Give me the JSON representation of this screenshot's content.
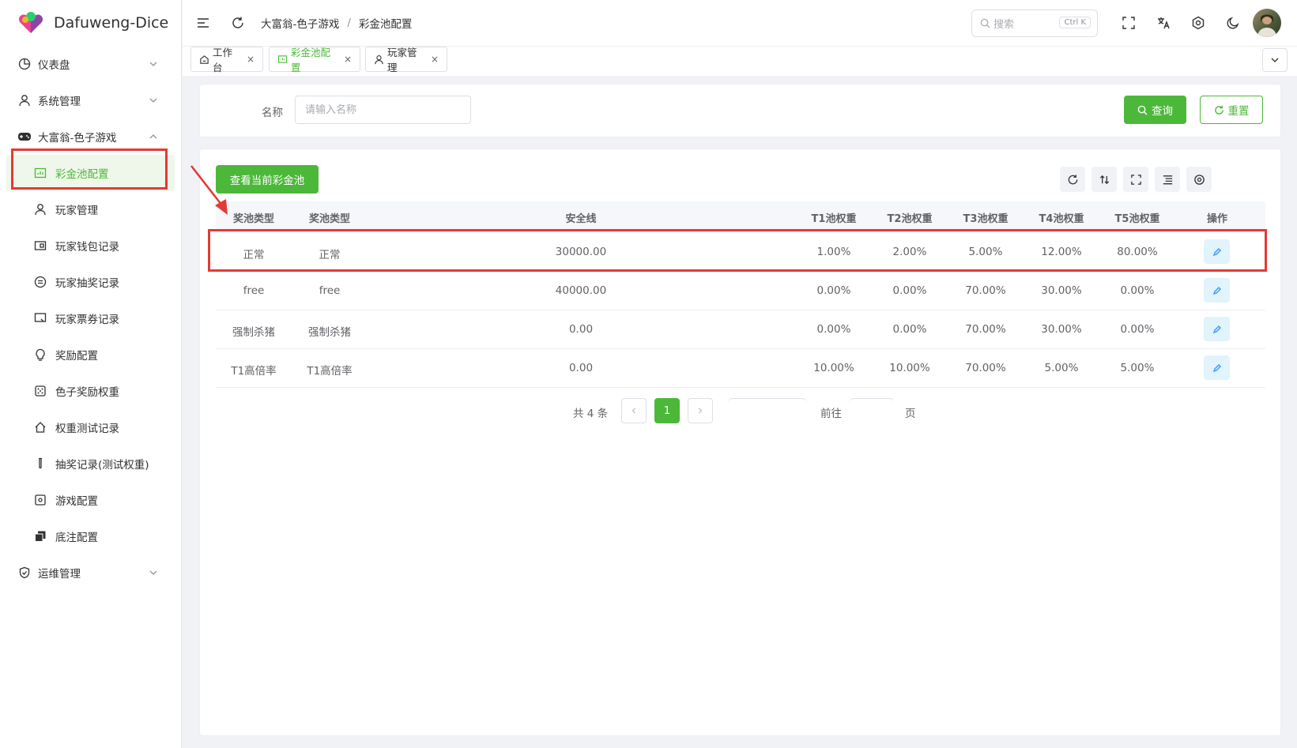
{
  "brand": {
    "name": "Dafuweng-Dice"
  },
  "sidebar": {
    "items": [
      {
        "label": "仪表盘"
      },
      {
        "label": "系统管理"
      },
      {
        "label": "大富翁-色子游戏"
      }
    ],
    "sub_items": [
      {
        "label": "彩金池配置"
      },
      {
        "label": "玩家管理"
      },
      {
        "label": "玩家钱包记录"
      },
      {
        "label": "玩家抽奖记录"
      },
      {
        "label": "玩家票券记录"
      },
      {
        "label": "奖励配置"
      },
      {
        "label": "色子奖励权重"
      },
      {
        "label": "权重测试记录"
      },
      {
        "label": "抽奖记录(测试权重)"
      },
      {
        "label": "游戏配置"
      },
      {
        "label": "底注配置"
      }
    ],
    "ops": {
      "label": "运维管理"
    }
  },
  "header": {
    "breadcrumb": [
      "大富翁-色子游戏",
      "彩金池配置"
    ],
    "search": {
      "placeholder": "搜索",
      "shortcut": "Ctrl K"
    }
  },
  "tabs": [
    {
      "label": "工作台"
    },
    {
      "label": "彩金池配置"
    },
    {
      "label": "玩家管理"
    }
  ],
  "filter": {
    "name_label": "名称",
    "name_placeholder": "请输入名称",
    "query_label": "查询",
    "reset_label": "重置"
  },
  "table": {
    "view_button": "查看当前彩金池",
    "columns": [
      "奖池类型",
      "奖池类型",
      "安全线",
      "T1池权重",
      "T2池权重",
      "T3池权重",
      "T4池权重",
      "T5池权重",
      "操作"
    ],
    "rows": [
      {
        "c1": "正常",
        "c2": "正常",
        "safe": "30000.00",
        "t1": "1.00%",
        "t2": "2.00%",
        "t3": "5.00%",
        "t4": "12.00%",
        "t5": "80.00%"
      },
      {
        "c1": "free",
        "c2": "free",
        "safe": "40000.00",
        "t1": "0.00%",
        "t2": "0.00%",
        "t3": "70.00%",
        "t4": "30.00%",
        "t5": "0.00%"
      },
      {
        "c1": "强制杀猪",
        "c2": "强制杀猪",
        "safe": "0.00",
        "t1": "0.00%",
        "t2": "0.00%",
        "t3": "70.00%",
        "t4": "30.00%",
        "t5": "0.00%"
      },
      {
        "c1": "T1高倍率",
        "c2": "T1高倍率",
        "safe": "0.00",
        "t1": "10.00%",
        "t2": "10.00%",
        "t3": "70.00%",
        "t4": "5.00%",
        "t5": "5.00%"
      }
    ]
  },
  "pager": {
    "total": "共 4 条",
    "current": "1",
    "goto": "前往",
    "page": "页"
  },
  "colors": {
    "accent": "#4cb83a",
    "annotation": "#e53935"
  }
}
